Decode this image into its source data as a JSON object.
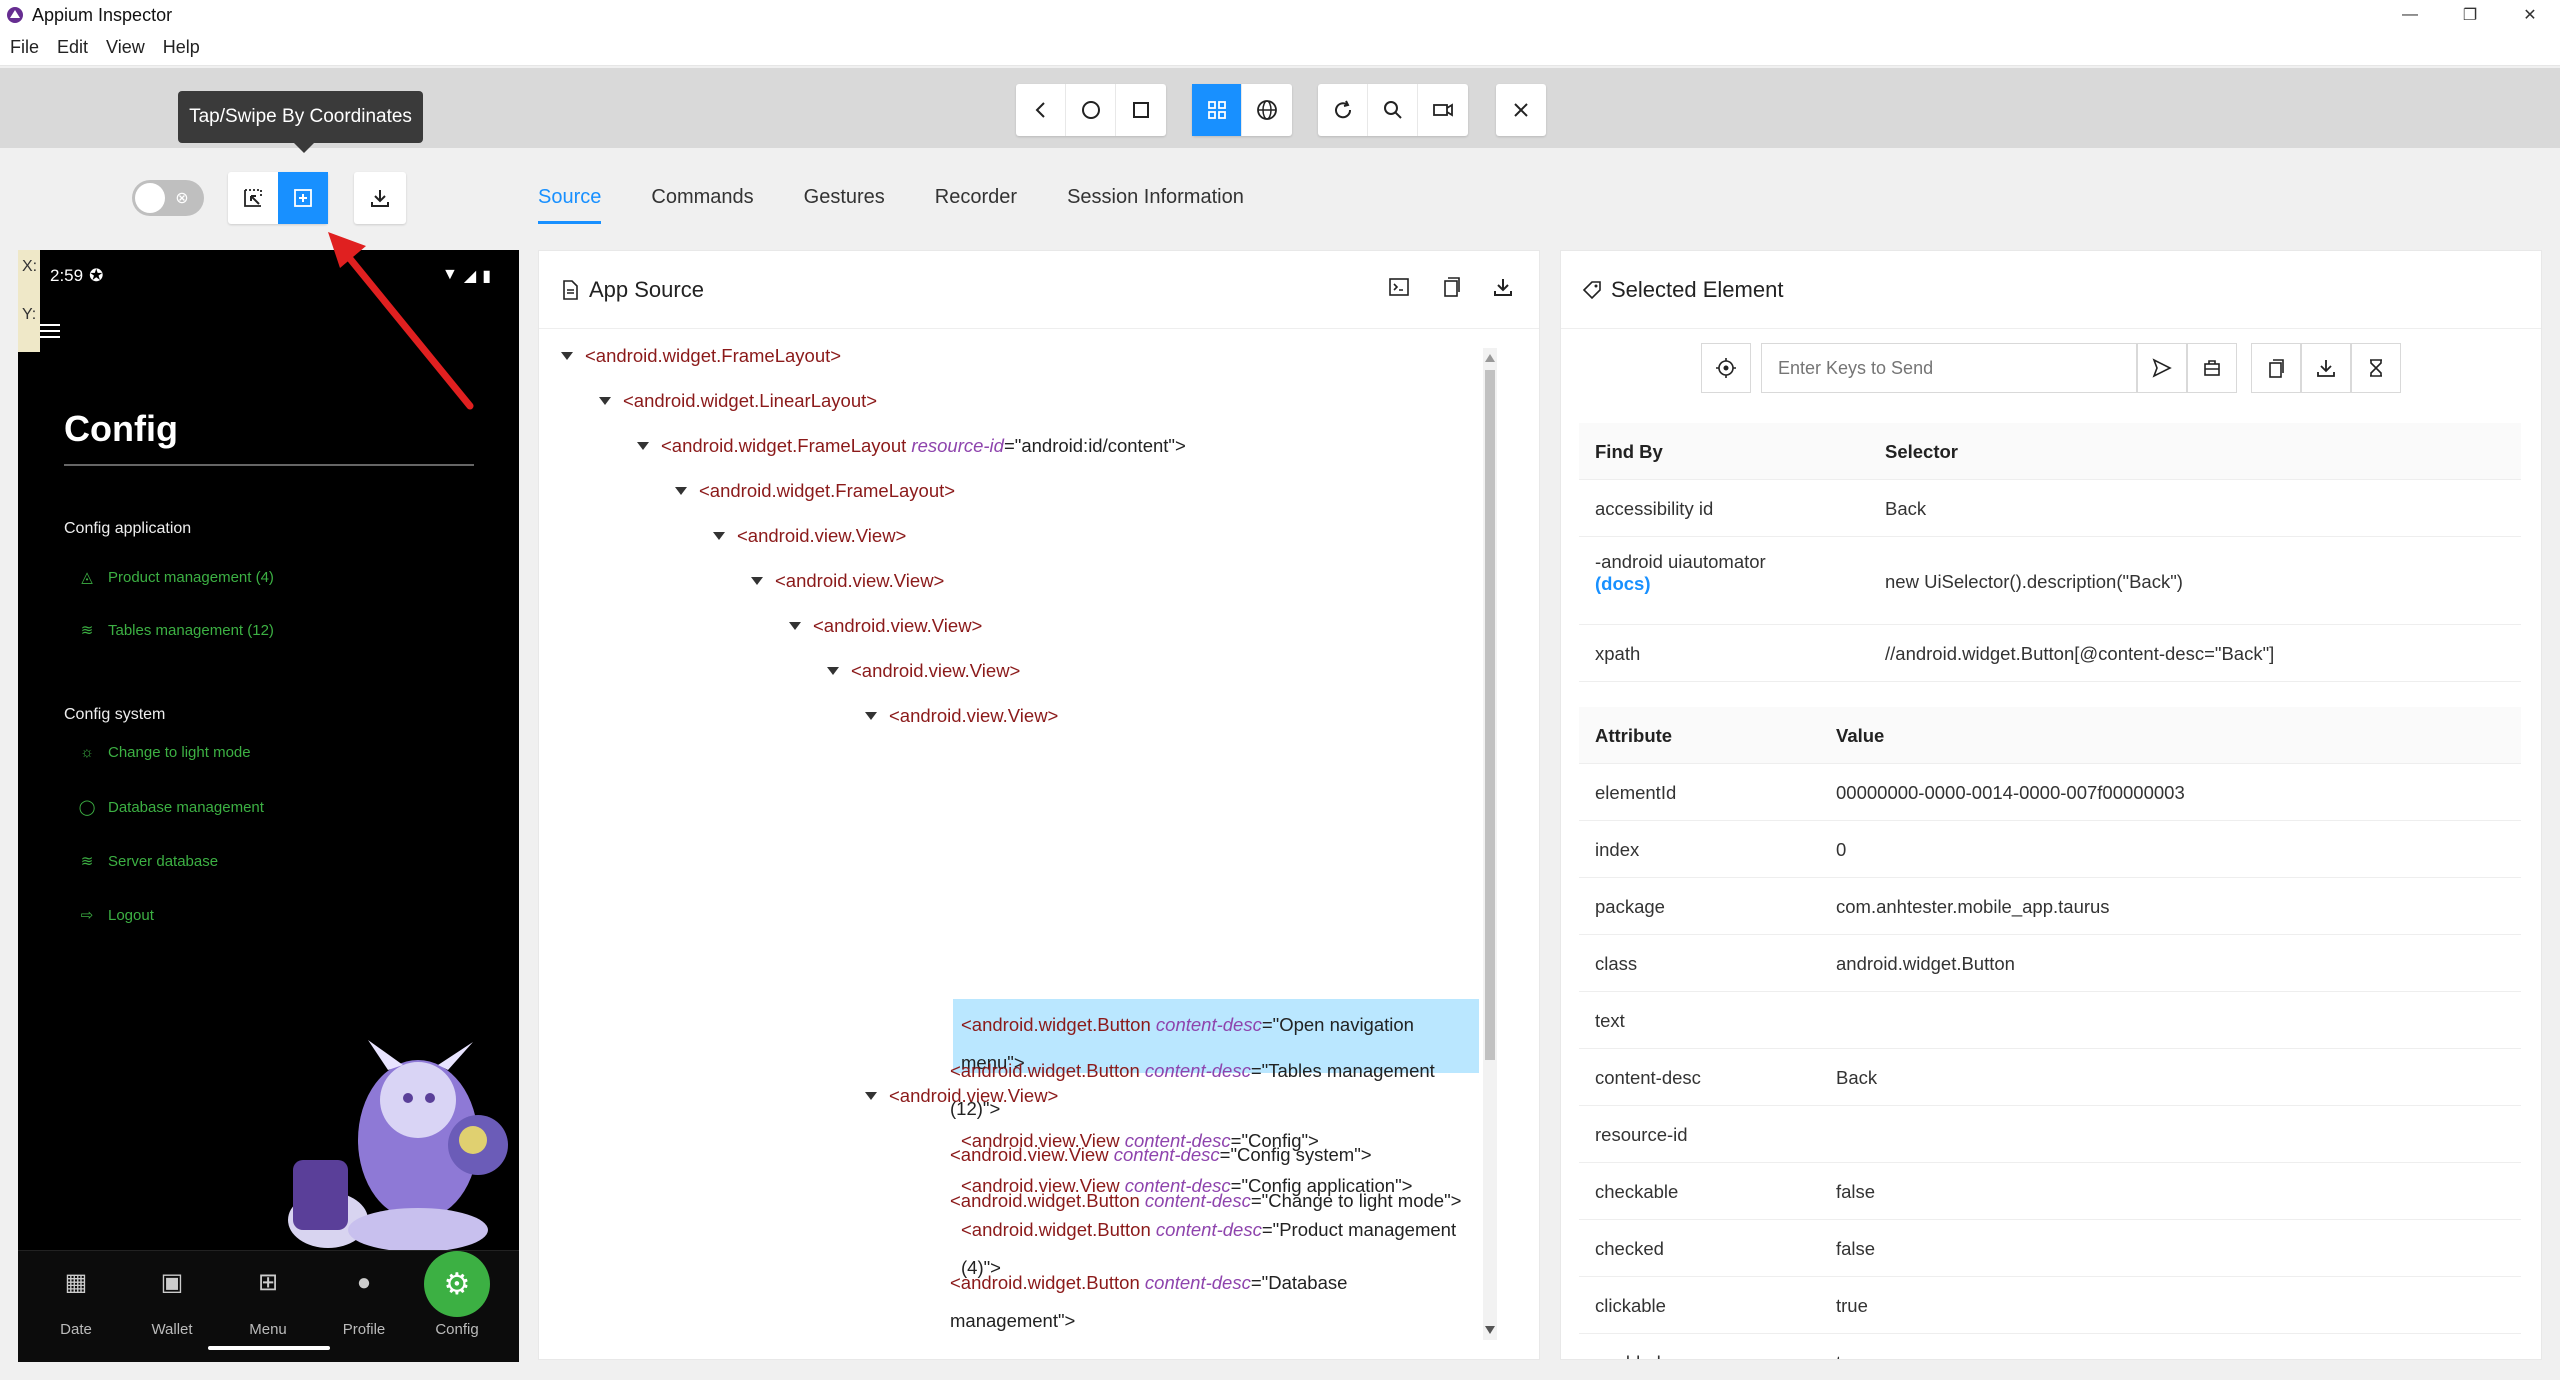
{
  "window": {
    "title": "Appium Inspector",
    "controls": [
      "—",
      "❐",
      "✕"
    ]
  },
  "menu": [
    "File",
    "Edit",
    "View",
    "Help"
  ],
  "tooltip": "Tap/Swipe By Coordinates",
  "tabs": [
    "Source",
    "Commands",
    "Gestures",
    "Recorder",
    "Session Information"
  ],
  "coords": {
    "x_label": "X:",
    "y_label": "Y:"
  },
  "phone": {
    "time": "2:59",
    "title": "Config",
    "section1": "Config application",
    "items1": [
      {
        "icon": "droplet-icon",
        "label": "Product management (4)"
      },
      {
        "icon": "wifi-icon",
        "label": "Tables management (12)"
      }
    ],
    "section2": "Config system",
    "items2": [
      {
        "icon": "sun-icon",
        "label": "Change to light mode"
      },
      {
        "icon": "circle-icon",
        "label": "Database management"
      },
      {
        "icon": "wifi-icon",
        "label": "Server database"
      },
      {
        "icon": "logout-icon",
        "label": "Logout"
      }
    ],
    "nav": [
      "Date",
      "Wallet",
      "Menu",
      "Profile",
      "Config"
    ],
    "accent": "#3cb043"
  },
  "source_panel": {
    "title": "App Source",
    "nodes": [
      {
        "tag": "<android.widget.FrameLayout>"
      },
      {
        "tag": "<android.widget.LinearLayout>"
      },
      {
        "tag": "<android.widget.FrameLayout",
        "attr": "resource-id",
        "val": "=\"android:id/content\">"
      },
      {
        "tag": "<android.widget.FrameLayout>"
      },
      {
        "tag": "<android.view.View>"
      },
      {
        "tag": "<android.view.View>"
      },
      {
        "tag": "<android.view.View>"
      },
      {
        "tag": "<android.view.View>"
      },
      {
        "tag": "<android.view.View>"
      },
      {
        "tag": "<android.widget.Button",
        "attr": "content-desc",
        "val": "=\"Open navigation menu\">"
      },
      {
        "tag": "<android.view.View>"
      },
      {
        "tag": "<android.view.View",
        "attr": "content-desc",
        "val": "=\"Config\">"
      },
      {
        "tag": "<android.view.View",
        "attr": "content-desc",
        "val": "=\"Config application\">"
      },
      {
        "tag": "<android.widget.Button",
        "attr": "content-desc",
        "val": "=\"Product management (4)\">"
      },
      {
        "tag": "<android.widget.Button",
        "attr": "content-desc",
        "val": "=\"Tables management (12)\">"
      },
      {
        "tag": "<android.view.View",
        "attr": "content-desc",
        "val": "=\"Config system\">"
      },
      {
        "tag": "<android.widget.Button",
        "attr": "content-desc",
        "val": "=\"Change to light mode\">"
      },
      {
        "tag": "<android.widget.Button",
        "attr": "content-desc",
        "val": "=\"Database management\">"
      }
    ]
  },
  "selected_panel": {
    "title": "Selected Element",
    "keys_placeholder": "Enter Keys to Send",
    "findby_header": [
      "Find By",
      "Selector"
    ],
    "findby_rows": [
      {
        "by": "accessibility id",
        "selector": "Back"
      },
      {
        "by": "-android uiautomator",
        "docs": "(docs)",
        "selector": "new UiSelector().description(\"Back\")"
      },
      {
        "by": "xpath",
        "selector": "//android.widget.Button[@content-desc=\"Back\"]"
      }
    ],
    "attr_header": [
      "Attribute",
      "Value"
    ],
    "attr_rows": [
      {
        "name": "elementId",
        "value": "00000000-0000-0014-0000-007f00000003"
      },
      {
        "name": "index",
        "value": "0"
      },
      {
        "name": "package",
        "value": "com.anhtester.mobile_app.taurus"
      },
      {
        "name": "class",
        "value": "android.widget.Button"
      },
      {
        "name": "text",
        "value": ""
      },
      {
        "name": "content-desc",
        "value": "Back"
      },
      {
        "name": "resource-id",
        "value": ""
      },
      {
        "name": "checkable",
        "value": "false"
      },
      {
        "name": "checked",
        "value": "false"
      },
      {
        "name": "clickable",
        "value": "true"
      },
      {
        "name": "enabled",
        "value": "true"
      }
    ]
  },
  "colors": {
    "primary": "#1890ff",
    "selected_row": "#bae7ff",
    "tag": "#8b1a1a",
    "attr": "#8e44ad"
  }
}
